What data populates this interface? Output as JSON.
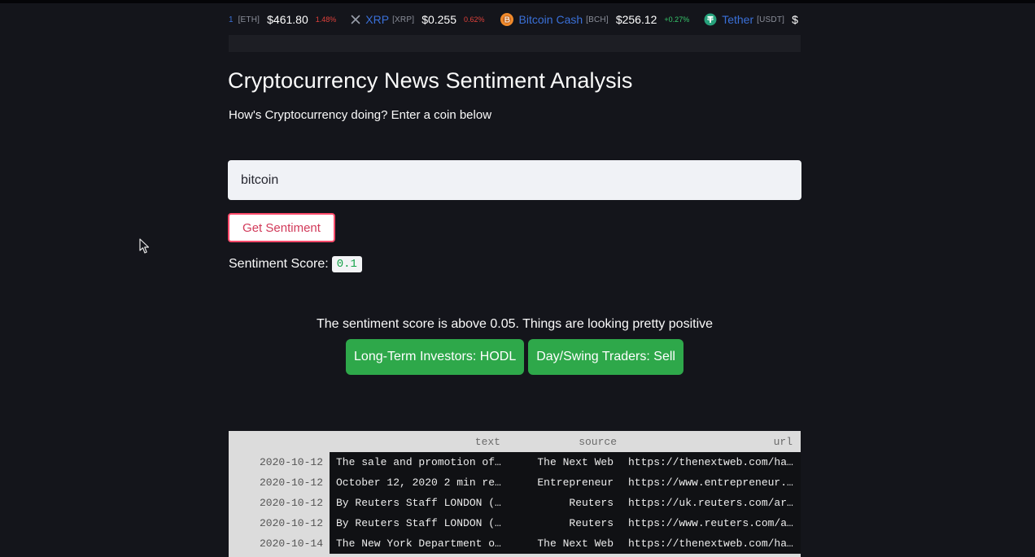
{
  "ticker": {
    "lead_symbol": "1",
    "items": [
      {
        "name": "",
        "symbol": "[ETH]",
        "price": "$461.80",
        "change": "1.48%",
        "direction": "neg",
        "icon": "none"
      },
      {
        "name": "XRP",
        "symbol": "[XRP]",
        "price": "$0.255",
        "change": "0.62%",
        "direction": "neg",
        "icon": "xrp-icon"
      },
      {
        "name": "Bitcoin Cash",
        "symbol": "[BCH]",
        "price": "$256.12",
        "change": "+0.27%",
        "direction": "pos",
        "icon": "bitcoin-cash-icon"
      },
      {
        "name": "Tether",
        "symbol": "[USDT]",
        "price": "$",
        "change": "",
        "direction": "pos",
        "icon": "tether-icon"
      }
    ],
    "colors": {
      "name": "#3a70d8",
      "negative": "#e0413b",
      "positive": "#37c76b"
    }
  },
  "page": {
    "title": "Cryptocurrency News Sentiment Analysis",
    "subtitle": "How's Cryptocurrency doing? Enter a coin below"
  },
  "input": {
    "value": "bitcoin",
    "placeholder": ""
  },
  "button": {
    "label": "Get Sentiment",
    "border_color": "#ff4b6b"
  },
  "sentiment": {
    "label": "Sentiment Score:",
    "score": "0.1"
  },
  "result": {
    "message": "The sentiment score is above 0.05. Things are looking pretty positive",
    "pills": [
      "Long-Term Investors: HODL",
      "Day/Swing Traders: Sell"
    ],
    "pill_color": "#2ea84a"
  },
  "table": {
    "columns": [
      "text",
      "source",
      "url"
    ],
    "rows": [
      {
        "index": "2020-10-12",
        "text": "The sale and promotion of…",
        "source": "The Next Web",
        "url": "https://thenextweb.com/ha…"
      },
      {
        "index": "2020-10-12",
        "text": "October 12, 2020 2 min re…",
        "source": "Entrepreneur",
        "url": "https://www.entrepreneur.…"
      },
      {
        "index": "2020-10-12",
        "text": "By Reuters Staff LONDON (…",
        "source": "Reuters",
        "url": "https://uk.reuters.com/ar…"
      },
      {
        "index": "2020-10-12",
        "text": "By Reuters Staff LONDON (…",
        "source": "Reuters",
        "url": "https://www.reuters.com/a…"
      },
      {
        "index": "2020-10-14",
        "text": "The New York Department o…",
        "source": "The Next Web",
        "url": "https://thenextweb.com/ha…"
      }
    ]
  },
  "theme": {
    "background": "#14151b",
    "input_background": "#f0f2f6",
    "code_text": "#16a34a"
  }
}
